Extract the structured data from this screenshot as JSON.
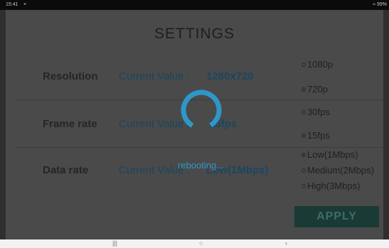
{
  "status_bar": {
    "time": "15:41",
    "notification": "×",
    "battery": "99%"
  },
  "page_title": "SETTINGS",
  "rows": [
    {
      "label": "Resolution",
      "current_prefix": "Current Value :",
      "current_value": "1280x720"
    },
    {
      "label": "Frame rate",
      "current_prefix": "Current Value :",
      "current_value": "15fps"
    },
    {
      "label": "Data rate",
      "current_prefix": "Current Value :",
      "current_value": "Low(1Mbps)"
    }
  ],
  "options": {
    "resolution": [
      {
        "label": "1080p",
        "selected": false
      },
      {
        "label": "720p",
        "selected": true
      }
    ],
    "frame_rate": [
      {
        "label": "30fps",
        "selected": false
      },
      {
        "label": "15fps",
        "selected": true
      }
    ],
    "data_rate": [
      {
        "label": "Low(1Mbps)",
        "selected": true
      },
      {
        "label": "Medium(2Mbps)",
        "selected": false
      },
      {
        "label": "High(3Mbps)",
        "selected": false
      }
    ]
  },
  "apply_label": "APPLY",
  "overlay": {
    "message": "rebooting..."
  },
  "nav": {
    "recents": "|||",
    "home": "○",
    "back": "‹"
  },
  "colors": {
    "spinner": "#2f97c8",
    "accent_text": "#1b4660",
    "apply_bg": "#1a3a36"
  }
}
